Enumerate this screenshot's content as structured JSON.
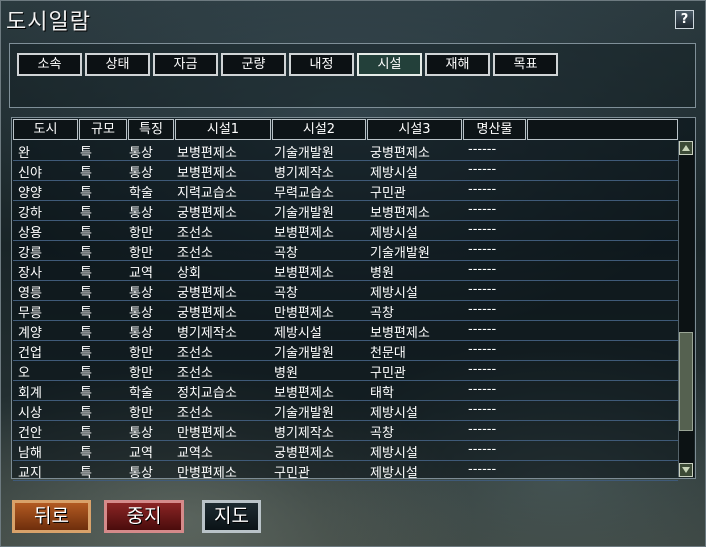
{
  "window": {
    "title": "도시일람",
    "help_label": "?"
  },
  "tabs": [
    {
      "label": "소속",
      "active": false
    },
    {
      "label": "상태",
      "active": false
    },
    {
      "label": "자금",
      "active": false
    },
    {
      "label": "군량",
      "active": false
    },
    {
      "label": "내정",
      "active": false
    },
    {
      "label": "시설",
      "active": true
    },
    {
      "label": "재해",
      "active": false
    },
    {
      "label": "목표",
      "active": false
    }
  ],
  "table": {
    "columns": [
      "도시",
      "규모",
      "특징",
      "시설1",
      "시설2",
      "시설3",
      "명산물",
      ""
    ],
    "rows": [
      [
        "완",
        "특",
        "통상",
        "보병편제소",
        "기술개발원",
        "궁병편제소",
        "------"
      ],
      [
        "신야",
        "특",
        "통상",
        "보병편제소",
        "병기제작소",
        "제방시설",
        "------"
      ],
      [
        "양양",
        "특",
        "학술",
        "지력교습소",
        "무력교습소",
        "구민관",
        "------"
      ],
      [
        "강하",
        "특",
        "통상",
        "궁병편제소",
        "기술개발원",
        "보병편제소",
        "------"
      ],
      [
        "상용",
        "특",
        "항만",
        "조선소",
        "보병편제소",
        "제방시설",
        "------"
      ],
      [
        "강릉",
        "특",
        "항만",
        "조선소",
        "곡창",
        "기술개발원",
        "------"
      ],
      [
        "장사",
        "특",
        "교역",
        "상회",
        "보병편제소",
        "병원",
        "------"
      ],
      [
        "영릉",
        "특",
        "통상",
        "궁병편제소",
        "곡창",
        "제방시설",
        "------"
      ],
      [
        "무릉",
        "특",
        "통상",
        "궁병편제소",
        "만병편제소",
        "곡창",
        "------"
      ],
      [
        "계양",
        "특",
        "통상",
        "병기제작소",
        "제방시설",
        "보병편제소",
        "------"
      ],
      [
        "건업",
        "특",
        "항만",
        "조선소",
        "기술개발원",
        "천문대",
        "------"
      ],
      [
        "오",
        "특",
        "항만",
        "조선소",
        "병원",
        "구민관",
        "------"
      ],
      [
        "회계",
        "특",
        "학술",
        "정치교습소",
        "보병편제소",
        "태학",
        "------"
      ],
      [
        "시상",
        "특",
        "항만",
        "조선소",
        "기술개발원",
        "제방시설",
        "------"
      ],
      [
        "건안",
        "특",
        "통상",
        "만병편제소",
        "병기제작소",
        "곡창",
        "------"
      ],
      [
        "남해",
        "특",
        "교역",
        "교역소",
        "궁병편제소",
        "제방시설",
        "------"
      ],
      [
        "교지",
        "특",
        "통상",
        "만병편제소",
        "구민관",
        "제방시설",
        "------"
      ]
    ]
  },
  "buttons": {
    "back": "뒤로",
    "stop": "중지",
    "map": "지도"
  },
  "scrollbar": {
    "position": 0.85
  }
}
